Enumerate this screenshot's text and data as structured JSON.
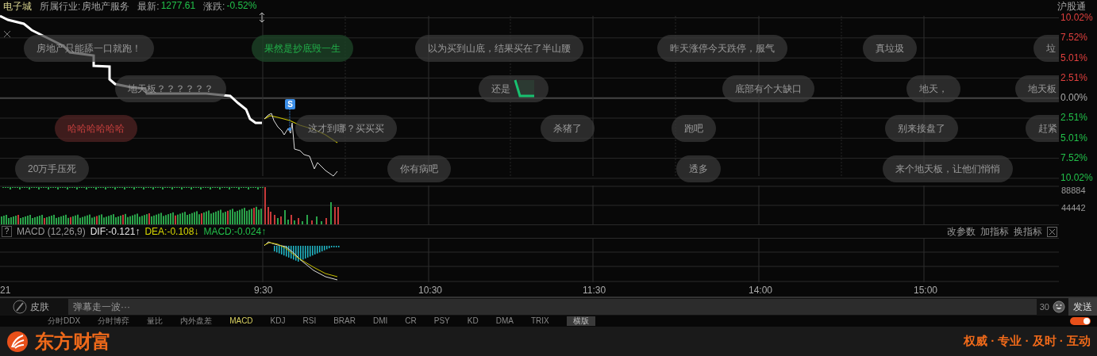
{
  "header": {
    "name": "电子城",
    "fields": [
      {
        "label": "所属行业:",
        "value": "房地产服务",
        "kind": "plain"
      },
      {
        "label": "最新:",
        "value": "1277.61",
        "kind": "fall"
      },
      {
        "label": "涨跌:",
        "value": "-0.52%",
        "kind": "fall"
      }
    ],
    "badge": "沪股通"
  },
  "price_axis": [
    {
      "label": "10.02%",
      "color": "#e0403e"
    },
    {
      "label": "7.52%",
      "color": "#e0403e"
    },
    {
      "label": "5.01%",
      "color": "#e0403e"
    },
    {
      "label": "2.51%",
      "color": "#e0403e"
    },
    {
      "label": "0.00%",
      "color": "#a8a8a8"
    },
    {
      "label": "2.51%",
      "color": "#22c04a"
    },
    {
      "label": "5.01%",
      "color": "#22c04a"
    },
    {
      "label": "7.52%",
      "color": "#22c04a"
    },
    {
      "label": "10.02%",
      "color": "#22c04a"
    }
  ],
  "signal_marker": "S",
  "danmaku": [
    {
      "text": "房地产只能舔一口就跑！",
      "color": "#9a9a9a",
      "kind": "text"
    },
    {
      "text": "果然是抄底毁一生",
      "color": "#22b04a",
      "kind": "text"
    },
    {
      "text": "以为买到山底，结果买在了半山腰",
      "color": "#9a9a9a",
      "kind": "text"
    },
    {
      "text": "昨天涨停今天跌停，服气",
      "color": "#9a9a9a",
      "kind": "text"
    },
    {
      "text": "真垃圾",
      "color": "#9a9a9a",
      "kind": "text"
    },
    {
      "text": "垃",
      "color": "#9a9a9a",
      "kind": "text"
    },
    {
      "text": "地天板？？？？？？",
      "color": "#9a9a9a",
      "kind": "text"
    },
    {
      "text": "还是",
      "color": "#9a9a9a",
      "kind": "image"
    },
    {
      "text": "底部有个大缺口",
      "color": "#9a9a9a",
      "kind": "text"
    },
    {
      "text": "地天，",
      "color": "#9a9a9a",
      "kind": "text"
    },
    {
      "text": "地天板",
      "color": "#9a9a9a",
      "kind": "text"
    },
    {
      "text": "哈哈哈哈哈哈",
      "color": "#c8403e",
      "kind": "text"
    },
    {
      "text": "这才到哪？买买买",
      "color": "#9a9a9a",
      "kind": "text"
    },
    {
      "text": "杀猪了",
      "color": "#9a9a9a",
      "kind": "text"
    },
    {
      "text": "跑吧",
      "color": "#9a9a9a",
      "kind": "text"
    },
    {
      "text": "别来接盘了",
      "color": "#9a9a9a",
      "kind": "text"
    },
    {
      "text": "赶紧",
      "color": "#9a9a9a",
      "kind": "text"
    },
    {
      "text": "20万手压死",
      "color": "#9a9a9a",
      "kind": "text"
    },
    {
      "text": "你有病吧",
      "color": "#9a9a9a",
      "kind": "text"
    },
    {
      "text": "透多",
      "color": "#9a9a9a",
      "kind": "text"
    },
    {
      "text": "来个地天板，让他们悄悄",
      "color": "#9a9a9a",
      "kind": "text"
    }
  ],
  "volume_axis": [
    "88884",
    "44442"
  ],
  "macd": {
    "help": "?",
    "title": "MACD (12,26,9)",
    "values": [
      {
        "text": "DIF:-0.121↑",
        "kind": "dif"
      },
      {
        "text": "DEA:-0.108↓",
        "kind": "dea"
      },
      {
        "text": "MACD:-0.024↑",
        "kind": "macd"
      }
    ],
    "actions": [
      "改参数",
      "加指标",
      "换指标"
    ]
  },
  "time_axis": [
    "21",
    "9:30",
    "10:30",
    "11:30",
    "14:00",
    "15:00"
  ],
  "comment_bar": {
    "skin": "皮肤",
    "placeholder": "弹幕走一波···",
    "count": "30",
    "send": "发送"
  },
  "indicator_tabs": [
    {
      "label": "分时DDX",
      "selected": false
    },
    {
      "label": "分时博弈",
      "selected": false
    },
    {
      "label": "量比",
      "selected": false
    },
    {
      "label": "内外盘差",
      "selected": false
    },
    {
      "label": "MACD",
      "selected": true
    },
    {
      "label": "KDJ",
      "selected": false
    },
    {
      "label": "RSI",
      "selected": false
    },
    {
      "label": "BRAR",
      "selected": false
    },
    {
      "label": "DMI",
      "selected": false
    },
    {
      "label": "CR",
      "selected": false
    },
    {
      "label": "PSY",
      "selected": false
    },
    {
      "label": "KD",
      "selected": false
    },
    {
      "label": "DMA",
      "selected": false
    },
    {
      "label": "TRIX",
      "selected": false
    }
  ],
  "layout_button": "横版",
  "live_toggle": {
    "on": true
  },
  "footer": {
    "brand": "东方财富",
    "slogan": "权威 · 专业 · 及时 · 互动"
  }
}
